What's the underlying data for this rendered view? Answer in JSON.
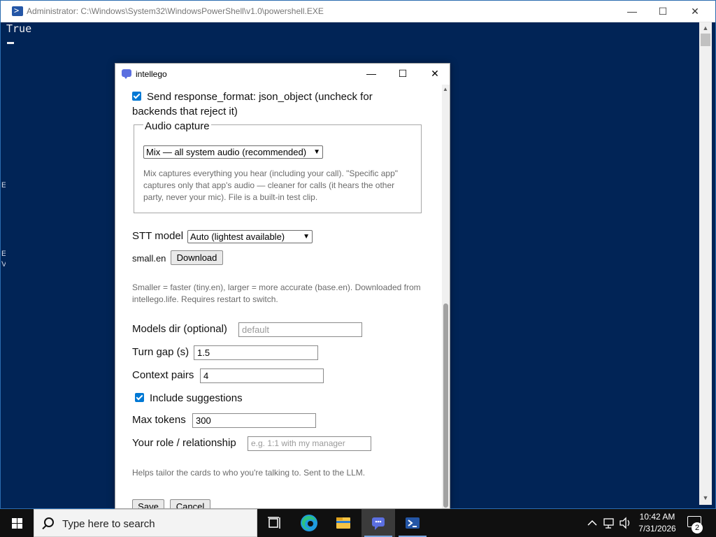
{
  "powershell": {
    "title": "Administrator: C:\\Windows\\System32\\WindowsPowerShell\\v1.0\\powershell.EXE",
    "output_line": "True",
    "edge_chars": [
      "E",
      "E",
      "V"
    ],
    "minimize_glyph": "—",
    "maximize_glyph": "☐",
    "close_glyph": "✕"
  },
  "dialog": {
    "title": "intellego",
    "minimize_glyph": "—",
    "maximize_glyph": "☐",
    "close_glyph": "✕",
    "response_format_label": "Send response_format: json_object (uncheck for backends that reject it)",
    "response_format_checked": true,
    "audio_capture": {
      "legend": "Audio capture",
      "selected": "Mix — all system audio (recommended)",
      "help": "Mix captures everything you hear (including your call). \"Specific app\" captures only that app's audio — cleaner for calls (it hears the other party, never your mic). File is a built-in test clip."
    },
    "stt": {
      "label": "STT model",
      "selected": "Auto (lightest available)",
      "current_model": "small.en",
      "download_label": "Download",
      "help": "Smaller = faster (tiny.en), larger = more accurate (base.en). Downloaded from intellego.life. Requires restart to switch."
    },
    "models_dir": {
      "label": "Models dir (optional)",
      "placeholder": "default",
      "value": ""
    },
    "turn_gap": {
      "label": "Turn gap (s)",
      "value": "1.5"
    },
    "context_pairs": {
      "label": "Context pairs",
      "value": "4"
    },
    "include_suggestions": {
      "label": "Include suggestions",
      "checked": true
    },
    "max_tokens": {
      "label": "Max tokens",
      "value": "300"
    },
    "role": {
      "label": "Your role / relationship",
      "placeholder": "e.g. 1:1 with my manager",
      "help": "Helps tailor the cards to who you're talking to. Sent to the LLM."
    },
    "save_label": "Save",
    "cancel_label": "Cancel"
  },
  "taskbar": {
    "search_placeholder": "Type here to search",
    "time": "10:42 AM",
    "date": "7/31/2026",
    "notification_count": "2",
    "pinned": [
      "task-view",
      "edge",
      "file-explorer",
      "intellego",
      "powershell"
    ],
    "active_app": "intellego"
  },
  "colors": {
    "powershell_bg": "#012456",
    "accent": "#0078d4",
    "taskbar_bg": "#101010"
  }
}
